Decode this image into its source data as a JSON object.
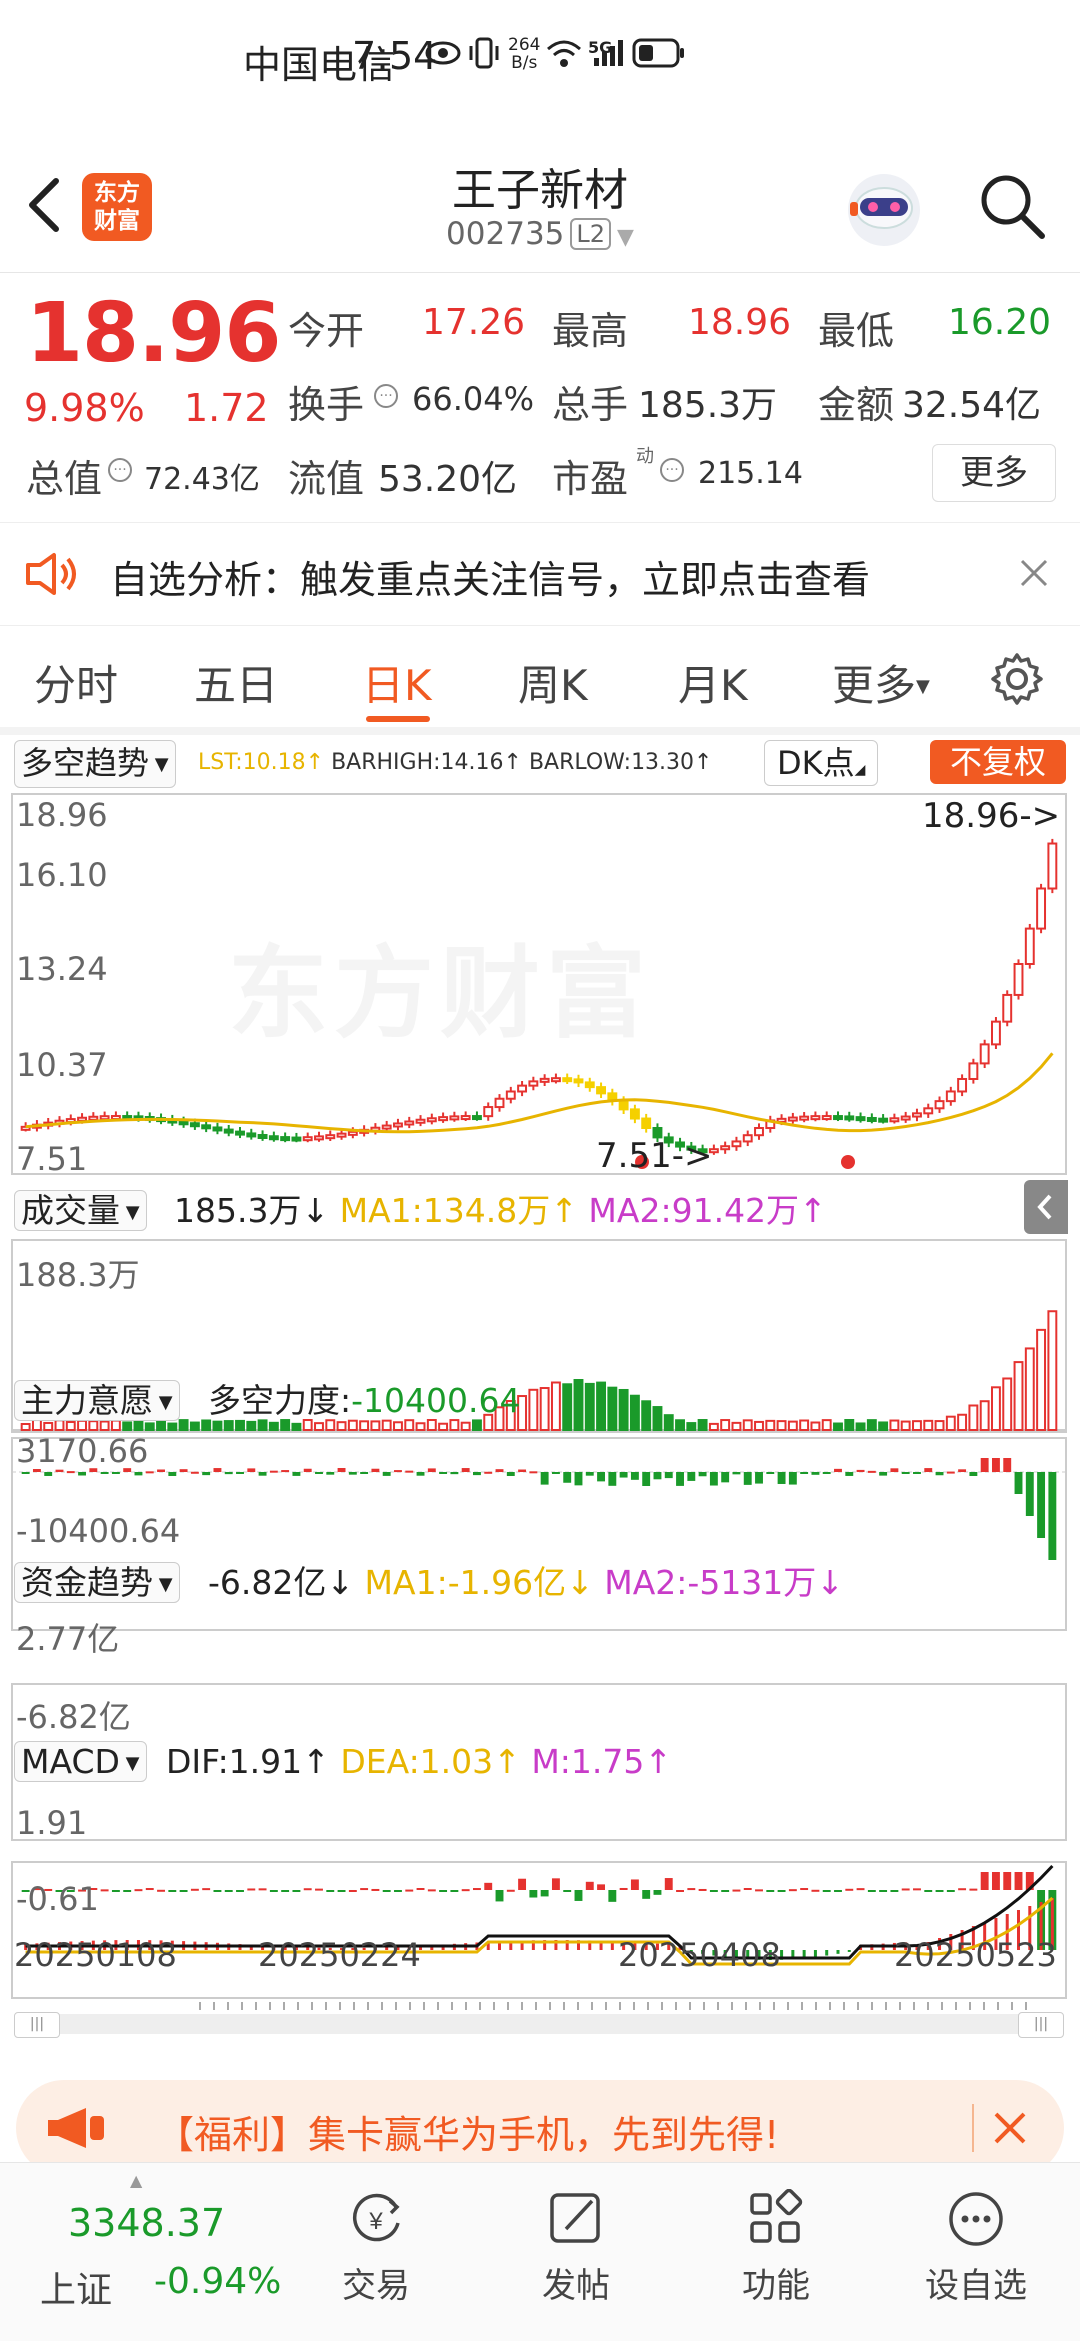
{
  "status_bar": {
    "carrier": "中国电信",
    "time": "7:54",
    "net_speed_top": "264",
    "net_speed_unit": "B/s",
    "network": "5G"
  },
  "header": {
    "title": "王子新材",
    "code": "002735",
    "level": "L2",
    "logo_text_1": "东方",
    "logo_text_2": "财富"
  },
  "quote": {
    "price": "18.96",
    "change_pct": "9.98%",
    "change": "1.72",
    "open_label": "今开",
    "open": "17.26",
    "high_label": "最高",
    "high": "18.96",
    "low_label": "最低",
    "low": "16.20",
    "turnover_label": "换手",
    "turnover": "66.04%",
    "volume_label": "总手",
    "volume": "185.3万",
    "amount_label": "金额",
    "amount": "32.54亿",
    "mktcap_label": "总值",
    "mktcap": "72.43亿",
    "float_label": "流值",
    "float_cap": "53.20亿",
    "pe_label": "市盈",
    "pe_sup": "动",
    "pe": "215.14",
    "more_button": "更多"
  },
  "notice": {
    "text": "自选分析：触发重点关注信号，立即点击查看"
  },
  "tabs": [
    "分时",
    "五日",
    "日K",
    "周K",
    "月K",
    "更多"
  ],
  "active_tab": 2,
  "kline": {
    "indicator": "多空趋势",
    "lst": "LST:10.18↑",
    "barhigh": "BARHIGH:14.16↑",
    "barlow": "BARLOW:13.30↑",
    "dk_button": "DK点",
    "fuquan_button": "不复权",
    "y_labels": [
      "18.96",
      "16.10",
      "13.24",
      "10.37",
      "7.51"
    ],
    "max_marker": "18.96->",
    "min_marker": "7.51->",
    "watermark": "东方财富"
  },
  "volume_panel": {
    "name": "成交量",
    "value": "185.3万↓",
    "ma1": "MA1:134.8万↑",
    "ma2": "MA2:91.42万↑",
    "y_top": "188.3万"
  },
  "force_panel": {
    "name": "主力意愿",
    "label": "多空力度:",
    "value": "-10400.64",
    "y_top": "3170.66",
    "y_bottom": "-10400.64"
  },
  "fund_panel": {
    "name": "资金趋势",
    "value": "-6.82亿↓",
    "ma1": "MA1:-1.96亿↓",
    "ma2": "MA2:-5131万↓",
    "y_top": "2.77亿",
    "y_bottom": "-6.82亿"
  },
  "macd_panel": {
    "name": "MACD",
    "dif": "DIF:1.91↑",
    "dea": "DEA:1.03↑",
    "m": "M:1.75↑",
    "y_top": "1.91",
    "y_bottom": "-0.61"
  },
  "dates": [
    "20250108",
    "20250224",
    "20250408",
    "20250523"
  ],
  "promo": {
    "text": "【福利】集卡赢华为手机，先到先得!"
  },
  "bottom_nav": {
    "index_value": "3348.37",
    "index_name": "上证",
    "index_change": "-0.94%",
    "items": [
      "交易",
      "发帖",
      "功能",
      "设自选"
    ]
  },
  "colors": {
    "up": "#e5322f",
    "down": "#1a9a2a",
    "accent": "#f15a22",
    "ma1": "#e7b400",
    "ma2": "#c83cc8"
  }
}
